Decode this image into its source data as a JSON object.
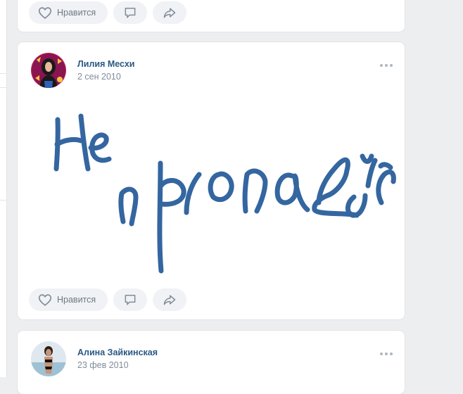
{
  "feed": {
    "top_post": {
      "like_label": "Нравится"
    },
    "post": {
      "author": "Лилия Месхи",
      "date": "2 сен 2010",
      "image_text": "Не пропадай",
      "like_label": "Нравится",
      "ink_color": "#3466a0"
    },
    "next_post": {
      "author": "Алина Зайкинская",
      "date": "23 фев 2010"
    }
  },
  "icons": [
    "heart-icon",
    "comment-icon",
    "share-icon",
    "more-icon"
  ]
}
